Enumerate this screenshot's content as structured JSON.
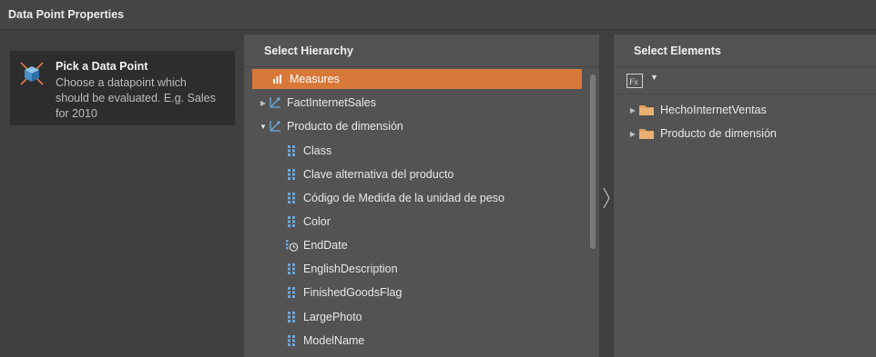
{
  "window": {
    "title": "Data Point Properties"
  },
  "step": {
    "title": "Pick a Data Point",
    "description": "Choose a datapoint which should be evaluated. E.g. Sales for 2010"
  },
  "hierarchy": {
    "title": "Select Hierarchy",
    "items": [
      {
        "label": "Measures",
        "icon": "bar-chart-icon",
        "selected": true,
        "expander": "none"
      },
      {
        "label": "FactInternetSales",
        "icon": "dimension-icon",
        "expander": "collapsed"
      },
      {
        "label": "Producto de dimensión",
        "icon": "dimension-icon",
        "expander": "expanded"
      },
      {
        "label": "Class",
        "icon": "hierarchy-icon"
      },
      {
        "label": "Clave alternativa del producto",
        "icon": "hierarchy-icon"
      },
      {
        "label": "Código de Medida de la unidad de peso",
        "icon": "hierarchy-icon"
      },
      {
        "label": "Color",
        "icon": "hierarchy-icon"
      },
      {
        "label": "EndDate",
        "icon": "time-hierarchy-icon"
      },
      {
        "label": "EnglishDescription",
        "icon": "hierarchy-icon"
      },
      {
        "label": "FinishedGoodsFlag",
        "icon": "hierarchy-icon"
      },
      {
        "label": "LargePhoto",
        "icon": "hierarchy-icon"
      },
      {
        "label": "ModelName",
        "icon": "hierarchy-icon"
      }
    ]
  },
  "elements": {
    "title": "Select Elements",
    "formula_icon": "fx-icon",
    "items": [
      {
        "label": "HechoInternetVentas",
        "icon": "folder-icon",
        "expander": "collapsed"
      },
      {
        "label": "Producto de dimensión",
        "icon": "folder-icon",
        "expander": "collapsed"
      }
    ]
  },
  "colors": {
    "selection": "#d8793a",
    "panel": "#535353",
    "background": "#3f3f3f",
    "folder": "#e0a060",
    "hierarchy_icon": "#6fa8dc"
  }
}
